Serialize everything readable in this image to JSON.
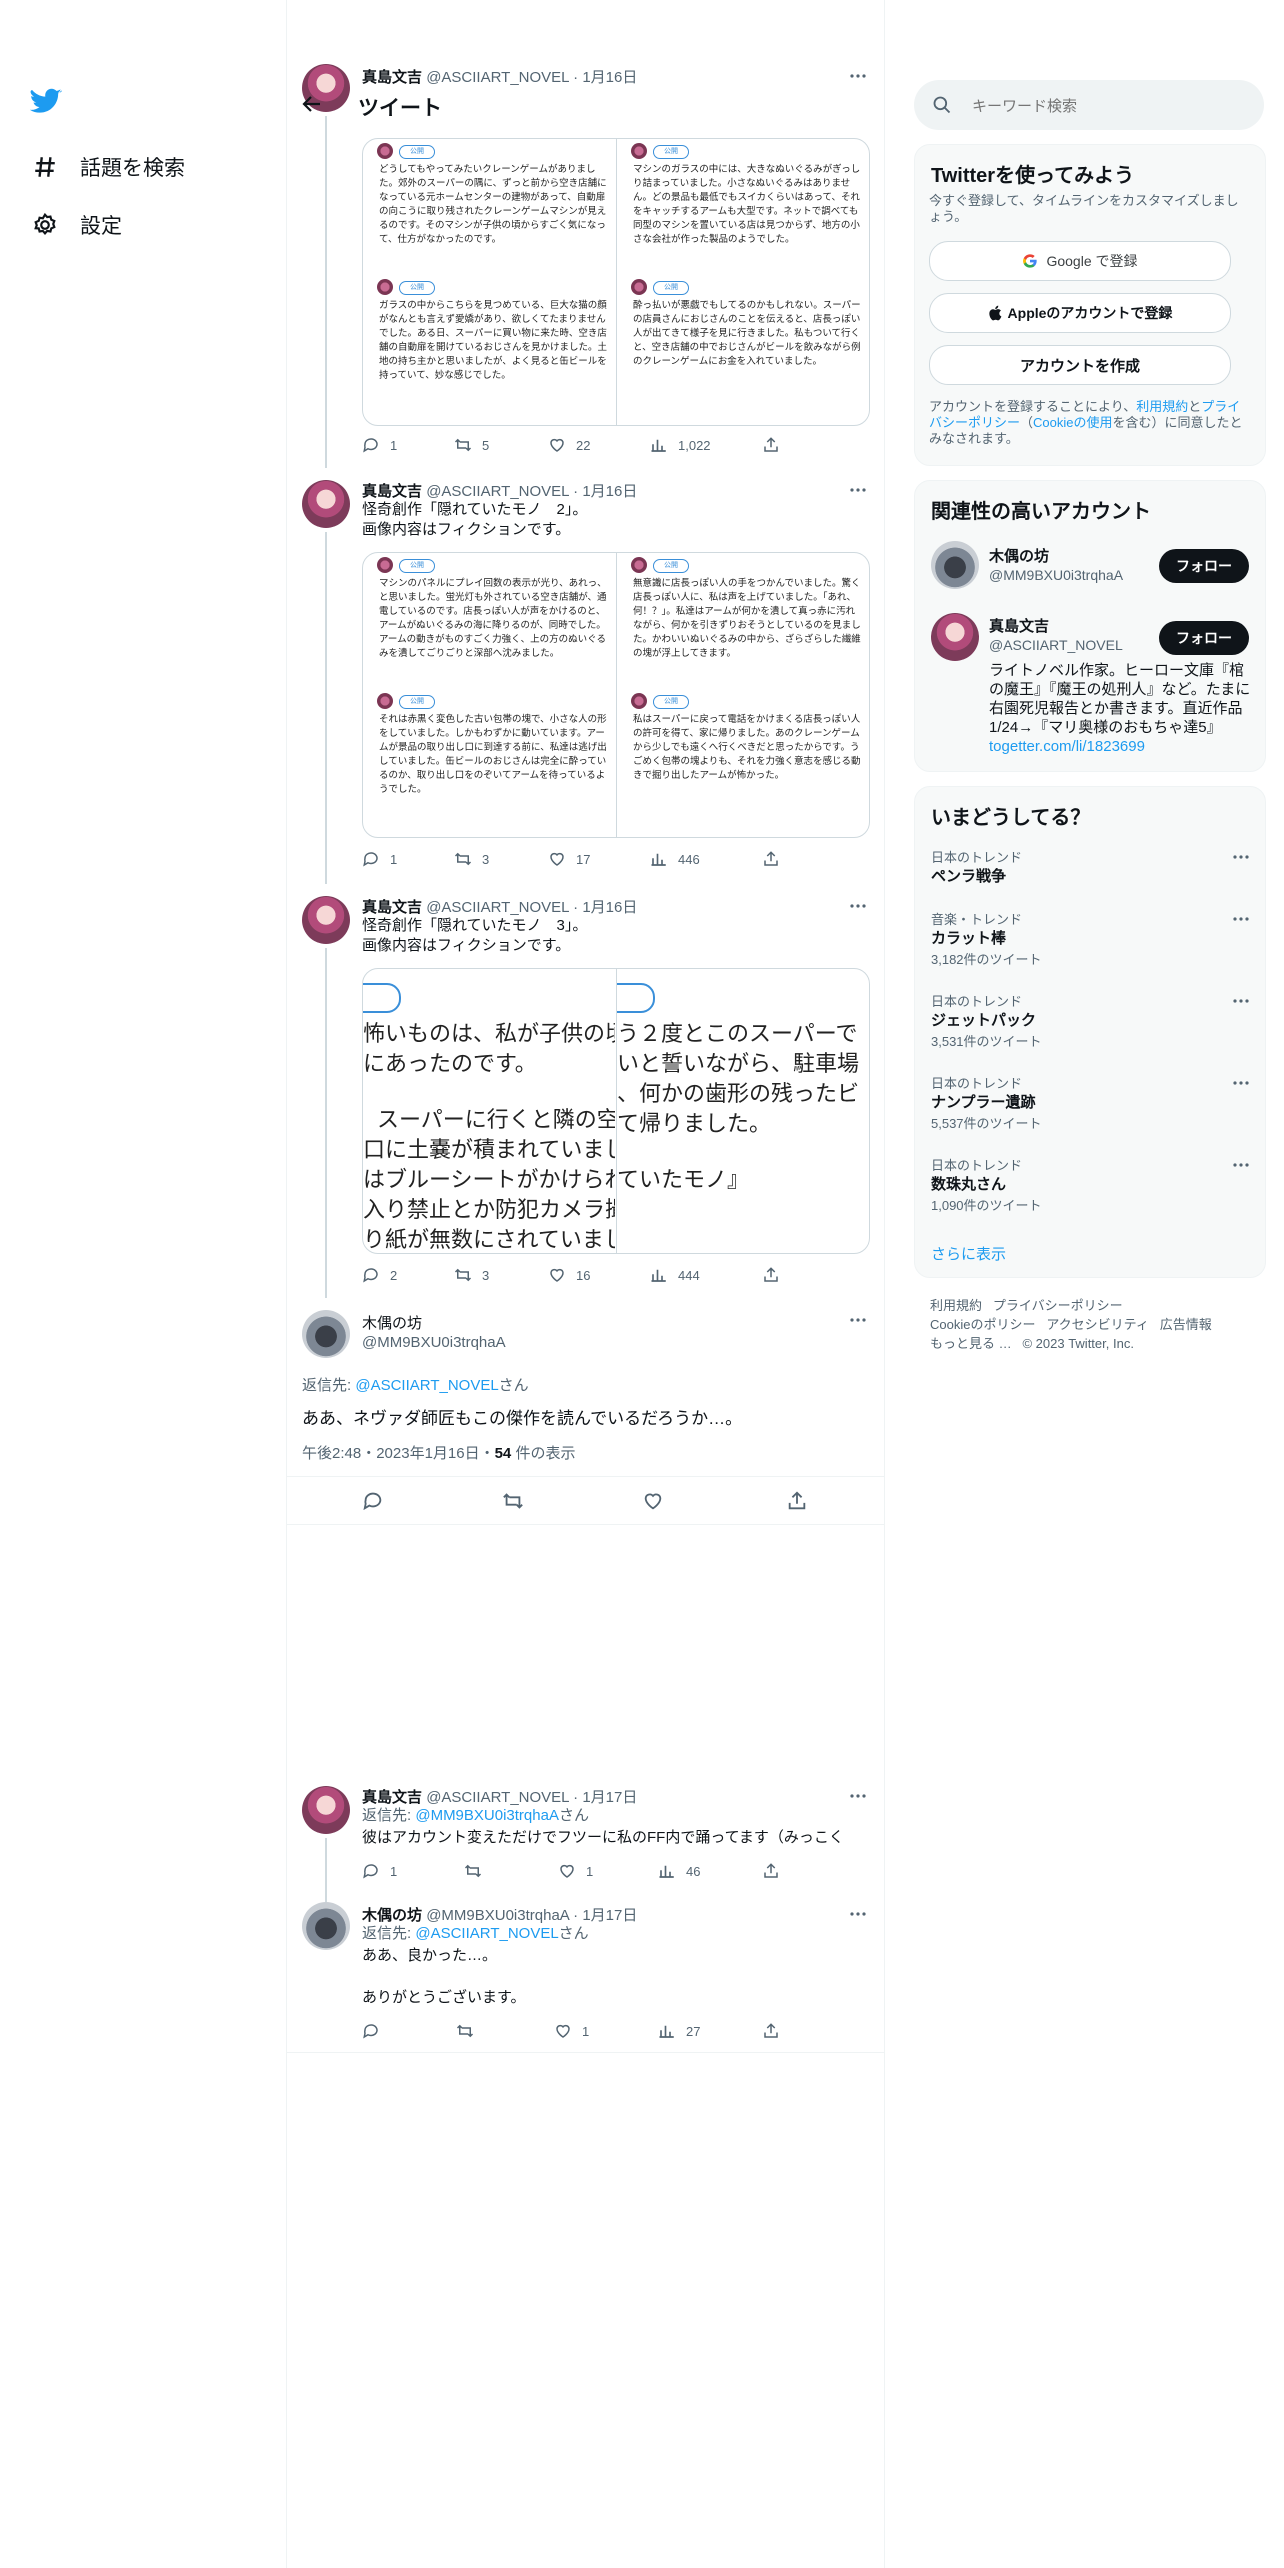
{
  "nav": {
    "logo": "twitter-bird-icon",
    "explore_label": "話題を検索",
    "settings_label": "設定"
  },
  "header": {
    "title": "ツイート"
  },
  "tweets": [
    {
      "name": "真島文吉",
      "handle": "@ASCIIART_NOVEL",
      "date": "1月16日",
      "panels": [
        {
          "chip": "公開",
          "text": "どうしてもやってみたいクレーンゲームがありました。郊外のスーパーの隅に、ずっと前から空き店舗になっている元ホームセンターの建物があって、自動扉の向こうに取り残されたクレーンゲームマシンが見えるのです。そのマシンが子供の頃からすごく気になって、仕方がなかったのです。"
        },
        {
          "chip": "公開",
          "text": "マシンのガラスの中には、大きなぬいぐるみがぎっしり詰まっていました。小さなぬいぐるみはありません。どの景品も最低でもスイカくらいはあって、それをキャッチするアームも大型です。ネットで調べても同型のマシンを置いている店は見つからず、地方の小さな会社が作った製品のようでした。"
        },
        {
          "chip": "公開",
          "text": "ガラスの中からこちらを見つめている、巨大な猫の顔がなんとも言えず愛嬌があり、欲しくてたまりませんでした。ある日、スーパーに買い物に来た時、空き店舗の自動扉を開けているおじさんを見かけました。土地の持ち主かと思いましたが、よく見ると缶ビールを持っていて、妙な感じでした。"
        },
        {
          "chip": "公開",
          "text": "酔っ払いが悪戯でもしてるのかもしれない。スーパーの店員さんにおじさんのことを伝えると、店長っぽい人が出てきて様子を見に行きました。私もついて行くと、空き店舗の中でおじさんがビールを飲みながら例のクレーンゲームにお金を入れていました。"
        }
      ],
      "stats": {
        "replies": "1",
        "retweets": "5",
        "likes": "22",
        "views": "1,022"
      }
    },
    {
      "name": "真島文吉",
      "handle": "@ASCIIART_NOVEL",
      "date": "1月16日",
      "text1": "怪奇創作「隠れていたモノ　2」。",
      "text2": "画像内容はフィクションです。",
      "panels": [
        {
          "chip": "公開",
          "text": "マシンのパネルにプレイ回数の表示が光り、あれっ、と思いました。蛍光灯も外されている空き店舗が、通電しているのです。店長っぽい人が声をかけるのと、アームがぬいぐるみの海に降りるのが、同時でした。アームの動きがものすごく力強く、上の方のぬいぐるみを潰してごりごりと深部へ沈みました。"
        },
        {
          "chip": "公開",
          "text": "無意識に店長っぽい人の手をつかんでいました。驚く店長っぽい人に、私は声を上げていました。「あれ、何！？」。私達はアームが何かを潰して真っ赤に汚れながら、何かを引きずりおそうとしているのを見ました。かわいいぬいぐるみの中から、ざらざらした繊維の塊が浮上してきます。"
        },
        {
          "chip": "公開",
          "text": "それは赤黒く変色した古い包帯の塊で、小さな人の形をしていました。しかもわずかに動いています。アームが景品の取り出し口に到達する前に、私達は逃げ出していました。缶ビールのおじさんは完全に酔っているのか、取り出し口をのぞいてアームを待っているようでした。"
        },
        {
          "chip": "公開",
          "text": "私はスーパーに戻って電話をかけまくる店長っぽい人の許可を得て、家に帰りました。あのクレーンゲームから少しでも遠くへ行くべきだと思ったからです。うごめく包帯の塊よりも、それを力強く意志を感じる動きで掘り出したアームが怖かった。"
        }
      ],
      "stats": {
        "replies": "1",
        "retweets": "3",
        "likes": "17",
        "views": "446"
      }
    },
    {
      "name": "真島文吉",
      "handle": "@ASCIIART_NOVEL",
      "date": "1月16日",
      "text1": "怪奇創作「隠れていたモノ　3」。",
      "text2": "画像内容はフィクションです。",
      "zoom_left": [
        "怖いものは、私が子供の頃",
        "にあったのです。",
        "",
        "スーパーに行くと隣の空",
        "口に土嚢が積まれていまし",
        "はブルーシートがかけられ",
        "入り禁止とか防犯カメラ撮",
        "り紙が無数にされていまし"
      ],
      "zoom_right": [
        "う２度とこのスーパーで",
        "いと誓いながら、駐車場",
        "、何かの歯形の残ったビ",
        "て帰りました。",
        "",
        "ていたモノ』"
      ],
      "stats": {
        "replies": "2",
        "retweets": "3",
        "likes": "16",
        "views": "444"
      }
    }
  ],
  "focus": {
    "name": "木偶の坊",
    "handle": "@MM9BXU0i3trqhaA",
    "reply_prefix": "返信先: ",
    "reply_to": "@ASCIIART_NOVEL",
    "reply_suffix": "さん",
    "text": "ああ、ネヴァダ師匠もこの傑作を読んでいるだろうか…。",
    "meta_time": "午後2:48・2023年1月16日・",
    "meta_views": "54",
    "meta_views_label": " 件の表示"
  },
  "replies": [
    {
      "name": "真島文吉",
      "handle": "@ASCIIART_NOVEL",
      "date": "1月17日",
      "reply_prefix": "返信先: ",
      "reply_to": "@MM9BXU0i3trqhaA",
      "reply_suffix": "さん",
      "text": "彼はアカウント変えただけでフツーに私のFF内で踊ってます（みっこく",
      "stats": {
        "replies": "1",
        "retweets": "",
        "likes": "1",
        "views": "46"
      }
    },
    {
      "name": "木偶の坊",
      "handle": "@MM9BXU0i3trqhaA",
      "date": "1月17日",
      "reply_prefix": "返信先: ",
      "reply_to": "@ASCIIART_NOVEL",
      "reply_suffix": "さん",
      "text": "ああ、良かった…。",
      "text2": "ありがとうございます。",
      "stats": {
        "replies": "",
        "retweets": "",
        "likes": "1",
        "views": "27"
      }
    }
  ],
  "search": {
    "placeholder": "キーワード検索"
  },
  "signup": {
    "title": "Twitterを使ってみよう",
    "subtitle": "今すぐ登録して、タイムラインをカスタマイズしましょう。",
    "google": "Google で登録",
    "apple": "Appleのアカウントで登録",
    "create": "アカウントを作成",
    "legal_pre": "アカウントを登録することにより、",
    "legal_link1": "利用規約",
    "legal_mid": "と",
    "legal_link2": "プライバシーポリシー",
    "legal_paren_open": "（",
    "legal_link3": "Cookieの使用",
    "legal_post": "を含む）に同意したとみなされます。"
  },
  "who": {
    "title": "関連性の高いアカウント",
    "follow": "フォロー",
    "accounts": [
      {
        "name": "木偶の坊",
        "handle": "@MM9BXU0i3trqhaA"
      },
      {
        "name": "真島文吉",
        "handle": "@ASCIIART_NOVEL",
        "bio": "ライトノベル作家。ヒーロー文庫『棺の魔王』『魔王の処刑人』など。たまに右園死児報告とか書きます。直近作品1/24→『マリ奥様のおもちゃ達5』",
        "bio_link": "togetter.com/li/1823699"
      }
    ]
  },
  "trends": {
    "title": "いまどうしてる？",
    "items": [
      {
        "cat": "日本のトレンド",
        "name": "ペンラ戦争",
        "count": ""
      },
      {
        "cat": "音楽・トレンド",
        "name": "カラット棒",
        "count": "3,182件のツイート"
      },
      {
        "cat": "日本のトレンド",
        "name": "ジェットパック",
        "count": "3,531件のツイート"
      },
      {
        "cat": "日本のトレンド",
        "name": "ナンプラー遺跡",
        "count": "5,537件のツイート"
      },
      {
        "cat": "日本のトレンド",
        "name": "数珠丸さん",
        "count": "1,090件のツイート"
      }
    ],
    "more": "さらに表示"
  },
  "footer": {
    "terms": "利用規約",
    "privacy": "プライバシーポリシー",
    "cookie": "Cookieのポリシー",
    "access": "アクセシビリティ",
    "ads": "広告情報",
    "more": "もっと見る …",
    "copyright": "© 2023 Twitter, Inc."
  }
}
